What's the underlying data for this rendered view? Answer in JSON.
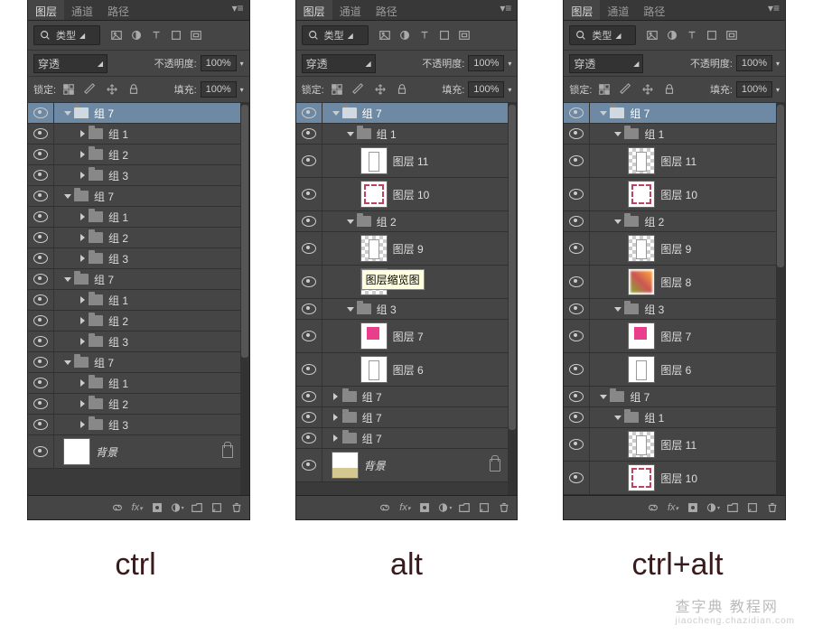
{
  "tabs": {
    "layers": "图层",
    "channels": "通道",
    "paths": "路径"
  },
  "type_label": "类型",
  "blend": "穿透",
  "opacity_label": "不透明度:",
  "opacity_value": "100%",
  "lock_label": "锁定:",
  "fill_label": "填充:",
  "fill_value": "100%",
  "background_label": "背景",
  "tooltip_text": "图层缩览图",
  "group_prefix": "组 ",
  "layer_prefix": "图层 ",
  "captions": {
    "ctrl": "ctrl",
    "alt": "alt",
    "ctrlalt": "ctrl+alt"
  },
  "watermark": {
    "main": "查字典 教程网",
    "sub": "jiaocheng.chazidian.com"
  },
  "panel1": {
    "rows": [
      {
        "t": "g",
        "n": "7",
        "d": 0,
        "o": true,
        "sel": true
      },
      {
        "t": "g",
        "n": "1",
        "d": 1,
        "o": false
      },
      {
        "t": "g",
        "n": "2",
        "d": 1,
        "o": false
      },
      {
        "t": "g",
        "n": "3",
        "d": 1,
        "o": false
      },
      {
        "t": "g",
        "n": "7",
        "d": 0,
        "o": true
      },
      {
        "t": "g",
        "n": "1",
        "d": 1,
        "o": false
      },
      {
        "t": "g",
        "n": "2",
        "d": 1,
        "o": false
      },
      {
        "t": "g",
        "n": "3",
        "d": 1,
        "o": false
      },
      {
        "t": "g",
        "n": "7",
        "d": 0,
        "o": true
      },
      {
        "t": "g",
        "n": "1",
        "d": 1,
        "o": false
      },
      {
        "t": "g",
        "n": "2",
        "d": 1,
        "o": false
      },
      {
        "t": "g",
        "n": "3",
        "d": 1,
        "o": false
      },
      {
        "t": "g",
        "n": "7",
        "d": 0,
        "o": true
      },
      {
        "t": "g",
        "n": "1",
        "d": 1,
        "o": false
      },
      {
        "t": "g",
        "n": "2",
        "d": 1,
        "o": false
      },
      {
        "t": "g",
        "n": "3",
        "d": 1,
        "o": false
      },
      {
        "t": "bg",
        "thumb": "bgp"
      }
    ],
    "thumb_h": 280
  },
  "panel2": {
    "rows": [
      {
        "t": "g",
        "n": "7",
        "d": 0,
        "o": true,
        "sel": true
      },
      {
        "t": "g",
        "n": "1",
        "d": 1,
        "o": true
      },
      {
        "t": "l",
        "n": "11",
        "d": 2,
        "thumb": "bar"
      },
      {
        "t": "l",
        "n": "10",
        "d": 2,
        "thumb": "dec"
      },
      {
        "t": "g",
        "n": "2",
        "d": 1,
        "o": true
      },
      {
        "t": "l",
        "n": "9",
        "d": 2,
        "thumb": "trans-bar"
      },
      {
        "t": "l",
        "n": "",
        "d": 2,
        "thumb": "trans",
        "tooltip": true
      },
      {
        "t": "g",
        "n": "3",
        "d": 1,
        "o": true
      },
      {
        "t": "l",
        "n": "7",
        "d": 2,
        "thumb": "sq"
      },
      {
        "t": "l",
        "n": "6",
        "d": 2,
        "thumb": "bar"
      },
      {
        "t": "g",
        "n": "7",
        "d": 0,
        "o": false
      },
      {
        "t": "g",
        "n": "7",
        "d": 0,
        "o": false
      },
      {
        "t": "g",
        "n": "7",
        "d": 0,
        "o": false
      },
      {
        "t": "bg",
        "thumb": "bg"
      }
    ],
    "thumb_h": 360
  },
  "panel3": {
    "rows": [
      {
        "t": "g",
        "n": "7",
        "d": 0,
        "o": true,
        "sel": true
      },
      {
        "t": "g",
        "n": "1",
        "d": 1,
        "o": true
      },
      {
        "t": "l",
        "n": "11",
        "d": 2,
        "thumb": "trans-bar"
      },
      {
        "t": "l",
        "n": "10",
        "d": 2,
        "thumb": "dec"
      },
      {
        "t": "g",
        "n": "2",
        "d": 1,
        "o": true
      },
      {
        "t": "l",
        "n": "9",
        "d": 2,
        "thumb": "trans-bar"
      },
      {
        "t": "l",
        "n": "8",
        "d": 2,
        "thumb": "pic"
      },
      {
        "t": "g",
        "n": "3",
        "d": 1,
        "o": true
      },
      {
        "t": "l",
        "n": "7",
        "d": 2,
        "thumb": "sq"
      },
      {
        "t": "l",
        "n": "6",
        "d": 2,
        "thumb": "bar"
      },
      {
        "t": "g",
        "n": "7",
        "d": 0,
        "o": true
      },
      {
        "t": "g",
        "n": "1",
        "d": 1,
        "o": true
      },
      {
        "t": "l",
        "n": "11",
        "d": 2,
        "thumb": "trans-bar"
      },
      {
        "t": "l",
        "n": "10",
        "d": 2,
        "thumb": "dec"
      }
    ],
    "thumb_h": 180
  }
}
